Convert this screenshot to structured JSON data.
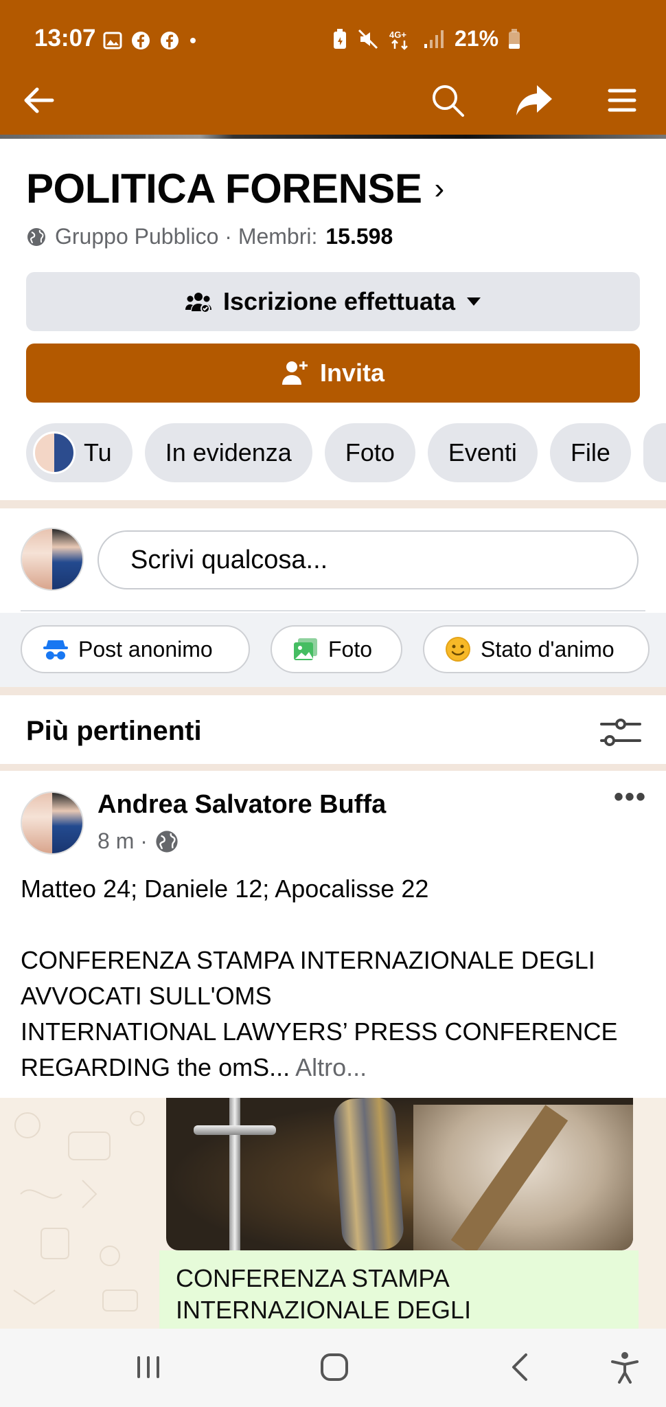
{
  "status_bar": {
    "time": "13:07",
    "battery": "21%",
    "left_icons": [
      "gallery-icon",
      "facebook-icon",
      "facebook-icon",
      "dot-icon"
    ],
    "right_icons": [
      "battery-saver-icon",
      "mute-icon",
      "network-4g-icon",
      "signal-icon"
    ]
  },
  "app_bar": {
    "icons": [
      "back-arrow-icon",
      "search-icon",
      "share-icon",
      "menu-icon"
    ],
    "color": "#b35900"
  },
  "group": {
    "title": "POLITICA FORENSE",
    "chevron": "›",
    "privacy": "Gruppo Pubblico · Membri:",
    "members": "15.598"
  },
  "buttons": {
    "joined_label": "Iscrizione effettuata",
    "invite_label": "Invita"
  },
  "chips": [
    {
      "label": "Tu"
    },
    {
      "label": "In evidenza"
    },
    {
      "label": "Foto"
    },
    {
      "label": "Eventi"
    },
    {
      "label": "File"
    }
  ],
  "composer": {
    "placeholder": "Scrivi qualcosa..."
  },
  "post_actions": [
    {
      "label": "Post anonimo",
      "icon": "anonymous-icon"
    },
    {
      "label": "Foto",
      "icon": "photo-icon"
    },
    {
      "label": "Stato d'animo",
      "icon": "smiley-icon"
    }
  ],
  "feed": {
    "sort_label": "Più pertinenti"
  },
  "post": {
    "author": "Andrea Salvatore Buffa",
    "time": "8 m ·",
    "line1": "Matteo 24; Daniele 12; Apocalisse 22",
    "line2": "CONFERENZA STAMPA INTERNAZIONALE DEGLI AVVOCATI SULL'OMS",
    "line3": "INTERNATIONAL LAWYERS’ PRESS CONFERENCE REGARDING the omS...",
    "more_link": "Altro...",
    "media_caption": "CONFERENZA STAMPA INTERNAZIONALE DEGLI"
  },
  "nav_bar": {
    "icons": [
      "recent-apps-icon",
      "home-icon",
      "back-icon",
      "accessibility-icon"
    ]
  }
}
